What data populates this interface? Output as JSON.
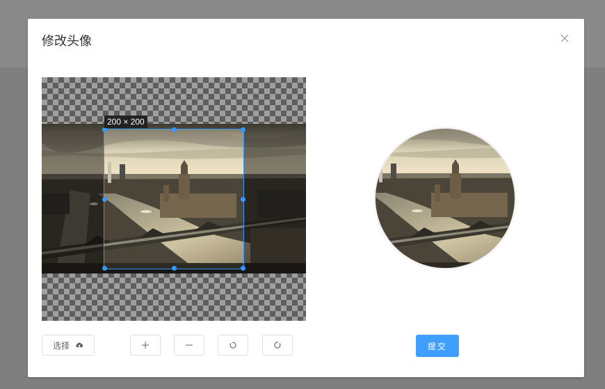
{
  "dialog": {
    "title": "修改头像",
    "close_icon": "close-icon"
  },
  "cropper": {
    "size_label": "200 × 200"
  },
  "toolbar": {
    "select_label": "选择",
    "select_icon": "cloud-upload-icon",
    "zoom_in_icon": "plus-icon",
    "zoom_out_icon": "minus-icon",
    "rotate_left_icon": "rotate-left-icon",
    "rotate_right_icon": "rotate-right-icon"
  },
  "submit_label": "提交",
  "colors": {
    "primary": "#409eff",
    "crop_outline": "#3399ff"
  }
}
